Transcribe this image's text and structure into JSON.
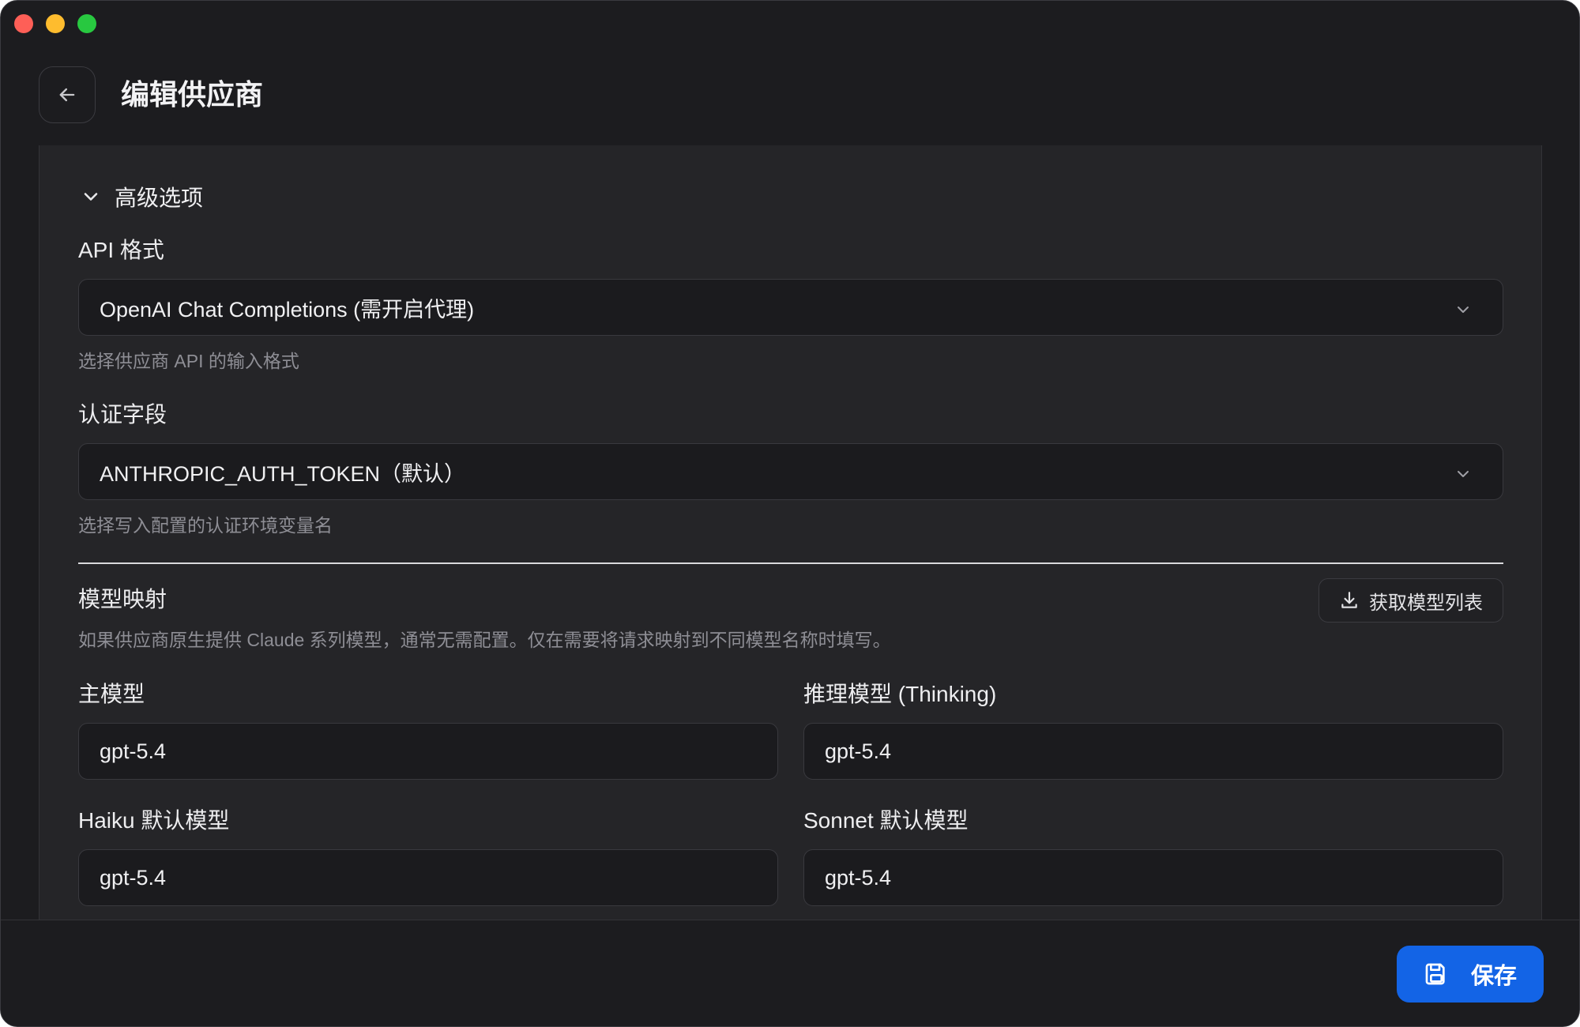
{
  "header": {
    "title": "编辑供应商"
  },
  "advanced": {
    "section_label": "高级选项",
    "api_format": {
      "label": "API 格式",
      "value": "OpenAI Chat Completions (需开启代理)",
      "hint": "选择供应商 API 的输入格式"
    },
    "auth_field": {
      "label": "认证字段",
      "value": "ANTHROPIC_AUTH_TOKEN（默认）",
      "hint": "选择写入配置的认证环境变量名"
    }
  },
  "model_mapping": {
    "title": "模型映射",
    "fetch_button": "获取模型列表",
    "description": "如果供应商原生提供 Claude 系列模型，通常无需配置。仅在需要将请求映射到不同模型名称时填写。",
    "main_model": {
      "label": "主模型",
      "value": "gpt-5.4"
    },
    "thinking_model": {
      "label": "推理模型 (Thinking)",
      "value": "gpt-5.4"
    },
    "haiku_model": {
      "label": "Haiku 默认模型",
      "value": "gpt-5.4"
    },
    "sonnet_model": {
      "label": "Sonnet 默认模型",
      "value": "gpt-5.4"
    }
  },
  "footer": {
    "save_label": "保存"
  },
  "colors": {
    "background": "#1c1c1f",
    "panel": "#252528",
    "accent": "#1364e6"
  },
  "icons": [
    "arrow-left-icon",
    "chevron-down-icon",
    "download-icon",
    "save-icon"
  ]
}
